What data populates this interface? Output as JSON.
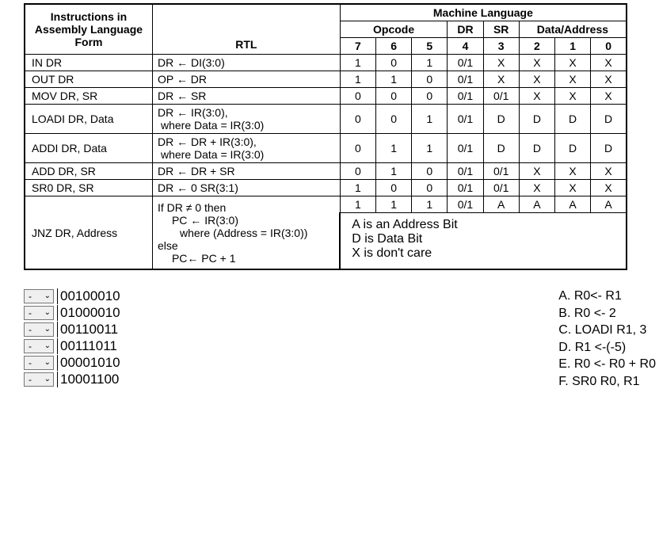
{
  "headers": {
    "instructions": "Instructions in Assembly Language Form",
    "rtl": "RTL",
    "ml": "Machine Language",
    "opcode": "Opcode",
    "dr": "DR",
    "sr": "SR",
    "data_addr": "Data/Address",
    "bit7": "7",
    "bit6": "6",
    "bit5": "5",
    "bit4": "4",
    "bit3": "3",
    "bit2": "2",
    "bit1": "1",
    "bit0": "0"
  },
  "rows": {
    "in": {
      "inst": "IN  DR",
      "rtl": "DR ← DI(3:0)",
      "b7": "1",
      "b6": "0",
      "b5": "1",
      "b4": "0/1",
      "b3": "X",
      "b2": "X",
      "b1": "X",
      "b0": "X"
    },
    "out": {
      "inst": "OUT  DR",
      "rtl": "OP ← DR",
      "b7": "1",
      "b6": "1",
      "b5": "0",
      "b4": "0/1",
      "b3": "X",
      "b2": "X",
      "b1": "X",
      "b0": "X"
    },
    "mov": {
      "inst": "MOV DR, SR",
      "rtl": "DR ← SR",
      "b7": "0",
      "b6": "0",
      "b5": "0",
      "b4": "0/1",
      "b3": "0/1",
      "b2": "X",
      "b1": "X",
      "b0": "X"
    },
    "loadi": {
      "inst": "LOADI DR, Data",
      "rtl1": "DR ← IR(3:0),",
      "rtl2": "where Data = IR(3:0)",
      "b7": "0",
      "b6": "0",
      "b5": "1",
      "b4": "0/1",
      "b3": "D",
      "b2": "D",
      "b1": "D",
      "b0": "D"
    },
    "addi": {
      "inst": "ADDI DR, Data",
      "rtl1": "DR ← DR + IR(3:0),",
      "rtl2": "where Data = IR(3:0)",
      "b7": "0",
      "b6": "1",
      "b5": "1",
      "b4": "0/1",
      "b3": "D",
      "b2": "D",
      "b1": "D",
      "b0": "D"
    },
    "add": {
      "inst": "ADD DR, SR",
      "rtl": "DR ← DR + SR",
      "b7": "0",
      "b6": "1",
      "b5": "0",
      "b4": "0/1",
      "b3": "0/1",
      "b2": "X",
      "b1": "X",
      "b0": "X"
    },
    "sr0": {
      "inst": "SR0 DR, SR",
      "rtl": "DR ← 0 SR(3:1)",
      "b7": "1",
      "b6": "0",
      "b5": "0",
      "b4": "0/1",
      "b3": "0/1",
      "b2": "X",
      "b1": "X",
      "b0": "X"
    },
    "jnz": {
      "inst": "JNZ DR, Address",
      "rtl1": "If DR ≠ 0 then",
      "rtl2": "PC ← IR(3:0)",
      "rtl3": "where (Address = IR(3:0))",
      "rtl4": "else",
      "rtl5": "PC← PC + 1",
      "b7": "1",
      "b6": "1",
      "b5": "1",
      "b4": "0/1",
      "b3": "A",
      "b2": "A",
      "b1": "A",
      "b0": "A"
    }
  },
  "legend": {
    "a": "A   is an Address Bit",
    "d": "D   is Data Bit",
    "x": "X   is don't care"
  },
  "matching": {
    "dd_label": "-",
    "codes": {
      "c0": "00100010",
      "c1": "01000010",
      "c2": "00110011",
      "c3": "00111011",
      "c4": "00001010",
      "c5": "10001100"
    },
    "answers": {
      "a": "A. R0<- R1",
      "b": "B. R0 <- 2",
      "c": "C. LOADI R1, 3",
      "d": "D. R1 <-(-5)",
      "e": "E. R0 <- R0 + R0",
      "f": "F. SR0 R0, R1"
    }
  },
  "chart_data": {
    "type": "table",
    "title": "Instruction set encoding",
    "columns": [
      "Assembly",
      "RTL",
      "7",
      "6",
      "5",
      "4",
      "3",
      "2",
      "1",
      "0"
    ],
    "rows": [
      [
        "IN DR",
        "DR←DI(3:0)",
        "1",
        "0",
        "1",
        "0/1",
        "X",
        "X",
        "X",
        "X"
      ],
      [
        "OUT DR",
        "OP←DR",
        "1",
        "1",
        "0",
        "0/1",
        "X",
        "X",
        "X",
        "X"
      ],
      [
        "MOV DR,SR",
        "DR←SR",
        "0",
        "0",
        "0",
        "0/1",
        "0/1",
        "X",
        "X",
        "X"
      ],
      [
        "LOADI DR,Data",
        "DR←IR(3:0), Data=IR(3:0)",
        "0",
        "0",
        "1",
        "0/1",
        "D",
        "D",
        "D",
        "D"
      ],
      [
        "ADDI DR,Data",
        "DR←DR+IR(3:0), Data=IR(3:0)",
        "0",
        "1",
        "1",
        "0/1",
        "D",
        "D",
        "D",
        "D"
      ],
      [
        "ADD DR,SR",
        "DR←DR+SR",
        "0",
        "1",
        "0",
        "0/1",
        "0/1",
        "X",
        "X",
        "X"
      ],
      [
        "SR0 DR,SR",
        "DR←0 SR(3:1)",
        "1",
        "0",
        "0",
        "0/1",
        "0/1",
        "X",
        "X",
        "X"
      ],
      [
        "JNZ DR,Address",
        "if DR≠0 PC←IR(3:0) else PC←PC+1",
        "1",
        "1",
        "1",
        "0/1",
        "A",
        "A",
        "A",
        "A"
      ]
    ],
    "legend": {
      "A": "Address Bit",
      "D": "Data Bit",
      "X": "don't care"
    }
  }
}
